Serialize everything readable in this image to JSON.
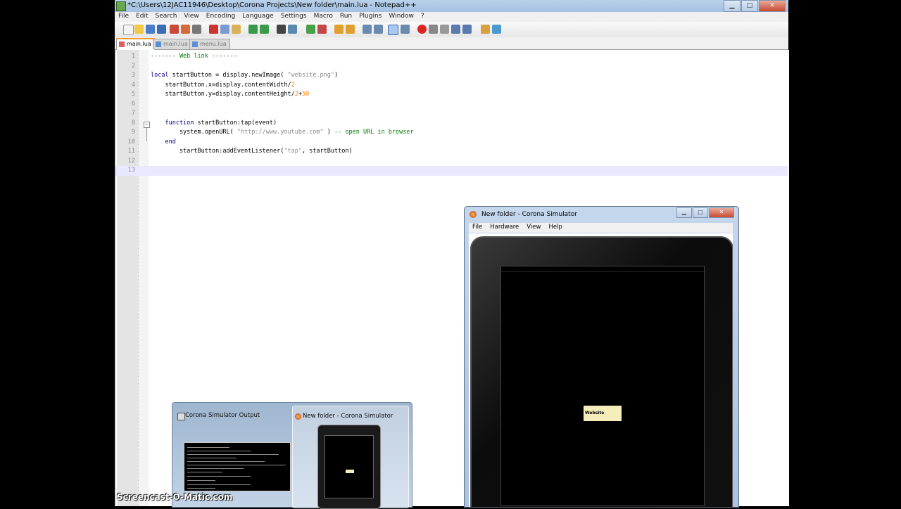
{
  "window": {
    "title": "*C:\\Users\\12JAC11946\\Desktop\\Corona Projects\\New folder\\main.lua - Notepad++",
    "minimize": "▁",
    "maximize": "□",
    "close": "✕"
  },
  "menu": [
    "File",
    "Edit",
    "Search",
    "View",
    "Encoding",
    "Language",
    "Settings",
    "Macro",
    "Run",
    "Plugins",
    "Window",
    "?"
  ],
  "tabs": [
    {
      "label": "main.lua",
      "active": true
    },
    {
      "label": "main.lua",
      "active": false
    },
    {
      "label": "menu.lua",
      "active": false
    }
  ],
  "code_lines": [
    {
      "n": "1"
    },
    {
      "n": "2"
    },
    {
      "n": "3"
    },
    {
      "n": "4"
    },
    {
      "n": "5"
    },
    {
      "n": "6"
    },
    {
      "n": "7"
    },
    {
      "n": "8"
    },
    {
      "n": "9"
    },
    {
      "n": "10"
    },
    {
      "n": "11"
    },
    {
      "n": "12"
    },
    {
      "n": "13"
    }
  ],
  "code": {
    "l1": "------- Web link -------",
    "l3_kw": "local",
    "l3_a": " startButton = display.newImage( ",
    "l3_s": "\"website.png\"",
    "l3_b": ")",
    "l4_a": "    startButton.x=display.contentWidth/",
    "l4_n": "2",
    "l5_a": "    startButton.y=display.contentHeight/",
    "l5_n": "2",
    "l5_b": "+",
    "l5_n2": "50",
    "l8_kw": "    function",
    "l8_a": " startButton:tap(event)",
    "l9_a": "        system.openURL( ",
    "l9_s": "\"http://www.youtube.com\"",
    "l9_b": " ) ",
    "l9_c": "-- open URL in browser",
    "l10_kw": "    end",
    "l11_a": "        startButton:addEventListener(",
    "l11_s": "\"tap\"",
    "l11_b": ", startButton)"
  },
  "simulator": {
    "title": "New folder - Corona Simulator",
    "menu": [
      "File",
      "Hardware",
      "View",
      "Help"
    ],
    "button_label": "Website"
  },
  "taskbar_preview": {
    "item1": "Corona Simulator Output",
    "item2": "New folder - Corona Simulator"
  },
  "watermark": "Screencast-O-Matic.com"
}
